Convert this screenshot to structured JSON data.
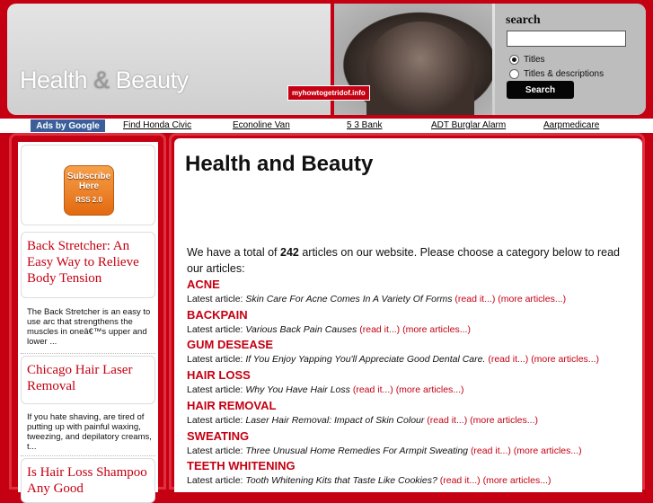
{
  "header": {
    "logo_word1": "Health",
    "logo_amp": "&",
    "logo_word2": "Beauty",
    "site_tag": "myhowtogetridof.info",
    "search": {
      "title": "search",
      "input_value": "",
      "option_titles": "Titles",
      "option_titles_desc": "Titles & descriptions",
      "selected_option": "Titles",
      "button": "Search"
    }
  },
  "adbar": {
    "label": "Ads by Google",
    "links": [
      "Find Honda Civic",
      "Econoline Van",
      "5 3 Bank",
      "ADT Burglar Alarm",
      "Aarpmedicare"
    ]
  },
  "sidebar": {
    "rss": {
      "line1": "Subscribe",
      "line2": "Here",
      "line3": "RSS 2.0"
    },
    "articles": [
      {
        "title": "Back Stretcher: An Easy Way to Relieve Body Tension",
        "excerpt": "The Back Stretcher is an easy to use arc that strengthens the muscles in oneâ€™s upper and lower ..."
      },
      {
        "title": "Chicago Hair Laser Removal",
        "excerpt": "If you hate shaving, are tired of putting up with painful waxing, tweezing, and depilatory creams, t..."
      },
      {
        "title": "Is Hair Loss Shampoo Any Good",
        "excerpt": ""
      }
    ]
  },
  "main": {
    "title": "Health and Beauty",
    "intro_pre": "We have a total of ",
    "intro_count": "242",
    "intro_post": " articles on our website. Please choose a category below to read our articles:",
    "latest_label": "Latest article: ",
    "read_it": "(read it...)",
    "more_articles": "(more articles...)",
    "categories": [
      {
        "name": "ACNE",
        "latest": "Skin Care For Acne Comes In A Variety Of Forms"
      },
      {
        "name": "BACKPAIN",
        "latest": "Various Back Pain Causes"
      },
      {
        "name": "GUM DESEASE",
        "latest": "If You Enjoy Yapping You'll Appreciate Good Dental Care."
      },
      {
        "name": "HAIR LOSS",
        "latest": "Why You Have Hair Loss"
      },
      {
        "name": "HAIR REMOVAL",
        "latest": "Laser Hair Removal: Impact of Skin Colour"
      },
      {
        "name": "SWEATING",
        "latest": "Three Unusual Home Remedies For Armpit Sweating"
      },
      {
        "name": "TEETH WHITENING",
        "latest": "Tooth Whitening Kits that Taste Like Cookies?"
      }
    ]
  },
  "colors": {
    "accent": "#c40012",
    "ads_label_bg": "#3b5f9b"
  }
}
